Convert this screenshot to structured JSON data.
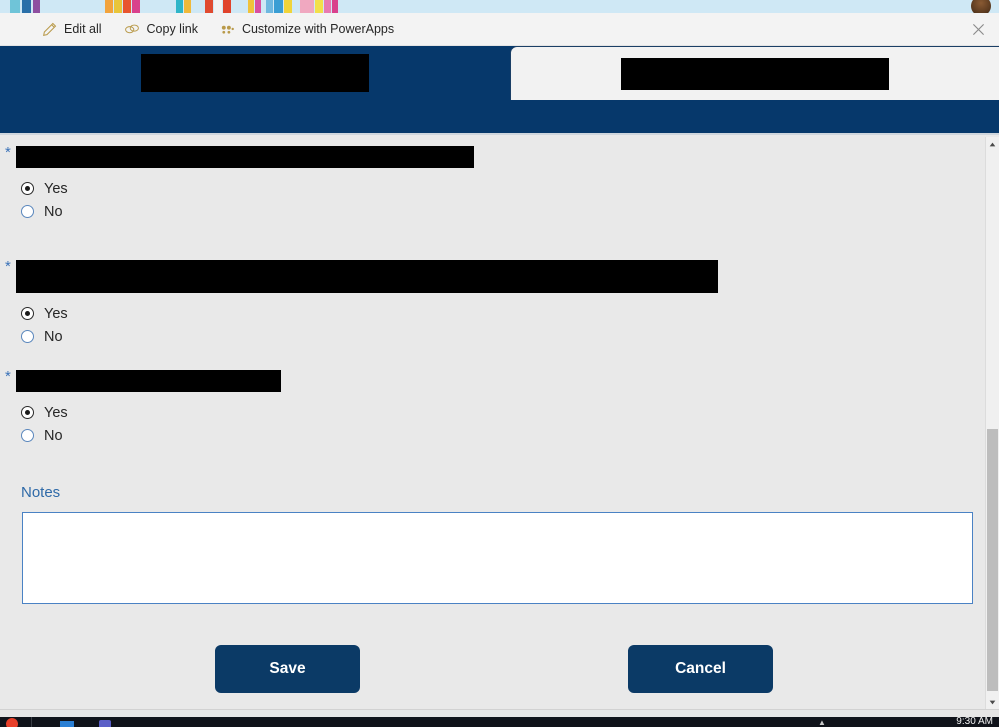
{
  "banner": {
    "avatar_name": "user-avatar",
    "background_color": "#cfe8f5"
  },
  "toolbar": {
    "items": [
      {
        "label": "Edit all",
        "icon": "pencil-icon"
      },
      {
        "label": "Copy link",
        "icon": "link-icon"
      },
      {
        "label": "Customize with PowerApps",
        "icon": "powerapps-icon"
      }
    ],
    "close_label": "✕"
  },
  "tabs": {
    "accent_color": "#06386b",
    "items": [
      {
        "name": "tab-one",
        "label": "",
        "redacted": true,
        "active": false
      },
      {
        "name": "tab-two",
        "label": "",
        "redacted": true,
        "active": true
      }
    ]
  },
  "form": {
    "required_marker": "*",
    "questions": [
      {
        "name": "question-1",
        "label": "",
        "redacted": true,
        "label_width": 458,
        "options": [
          {
            "label": "Yes",
            "selected": true
          },
          {
            "label": "No",
            "selected": false
          }
        ]
      },
      {
        "name": "question-2",
        "label": "",
        "redacted": true,
        "label_width": 702,
        "options": [
          {
            "label": "Yes",
            "selected": true
          },
          {
            "label": "No",
            "selected": false
          }
        ]
      },
      {
        "name": "question-3",
        "label": "",
        "redacted": true,
        "label_width": 265,
        "options": [
          {
            "label": "Yes",
            "selected": true
          },
          {
            "label": "No",
            "selected": false
          }
        ]
      }
    ],
    "notes": {
      "label": "Notes",
      "value": "",
      "placeholder": ""
    },
    "buttons": {
      "save_label": "Save",
      "cancel_label": "Cancel",
      "color": "#0b3a66"
    }
  },
  "scrollbar": {
    "up_arrow": "▲",
    "down_arrow": "▼"
  },
  "taskbar": {
    "clock": "9:30 AM",
    "caret": "▲"
  }
}
